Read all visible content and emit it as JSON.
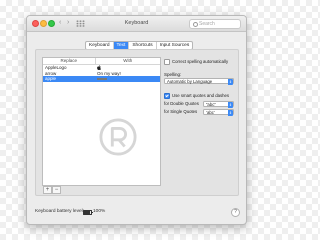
{
  "window": {
    "title": "Keyboard",
    "search_placeholder": "Search",
    "back_glyph": "‹",
    "forward_glyph": "›"
  },
  "tabs": [
    {
      "label": "Keyboard",
      "active": false
    },
    {
      "label": "Text",
      "active": true
    },
    {
      "label": "Shortcuts",
      "active": false
    },
    {
      "label": "Input Sources",
      "active": false
    }
  ],
  "replacements": {
    "headers": {
      "replace": "Replace",
      "with": "With"
    },
    "rows": [
      {
        "replace": "AppleLogo",
        "with": "",
        "selected": false
      },
      {
        "replace": "arrow",
        "with": "On my way!",
        "selected": false
      },
      {
        "replace": "apple",
        "with": "",
        "selected": true
      }
    ],
    "add_glyph": "+",
    "remove_glyph": "−"
  },
  "options": {
    "correct_spelling_label": "Correct spelling automatically",
    "correct_spelling_checked": false,
    "spelling_label": "Spelling:",
    "spelling_value": "Automatic by Language",
    "smart_quotes_label": "Use smart quotes and dashes",
    "smart_quotes_checked": true,
    "double_quotes_label": "for Double Quotes",
    "double_quotes_value": "“abc”",
    "single_quotes_label": "for Single Quotes",
    "single_quotes_value": "‘abc’",
    "popup_arrows": "⇕"
  },
  "footer": {
    "battery_label": "Keyboard battery level:",
    "battery_value": "100%",
    "help_glyph": "?"
  },
  "icons": {
    "watermark": "redmond-pie-logo-icon",
    "search": "search-icon",
    "battery": "battery-icon"
  },
  "colors": {
    "accent": "#3b89f5",
    "close": "#fc605c",
    "minimize": "#fdbc40",
    "maximize": "#34c84a"
  }
}
